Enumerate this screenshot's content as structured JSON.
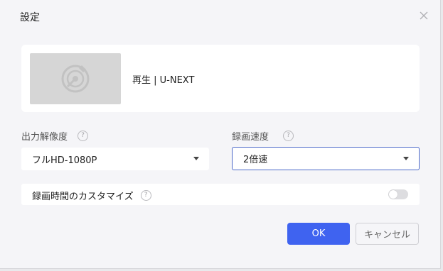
{
  "dialog": {
    "title": "設定"
  },
  "video": {
    "title": "再生 | U-NEXT",
    "thumbnail_icon": "disc-icon"
  },
  "resolution": {
    "label": "出力解像度",
    "value": "フルHD-1080P"
  },
  "speed": {
    "label": "録画速度",
    "value": "2倍速"
  },
  "custom_time": {
    "label": "録画時間のカスタマイズ",
    "enabled": false
  },
  "help_glyph": "?",
  "buttons": {
    "ok": "OK",
    "cancel": "キャンセル"
  },
  "colors": {
    "accent": "#3f63f0",
    "background": "#f5f5f8"
  }
}
